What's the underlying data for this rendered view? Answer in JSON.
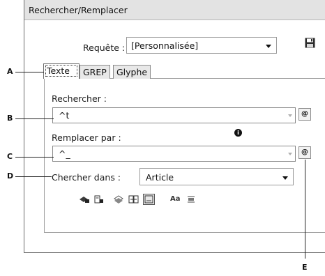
{
  "dialog": {
    "title": "Rechercher/Remplacer",
    "query_label": "Requête :",
    "query_value": "[Personnalisée]"
  },
  "tabs": [
    {
      "label": "Texte",
      "active": true
    },
    {
      "label": "GREP",
      "active": false
    },
    {
      "label": "Glyphe",
      "active": false
    }
  ],
  "find": {
    "label": "Rechercher :",
    "value": "^t"
  },
  "replace": {
    "label": "Remplacer par :",
    "value": "^_"
  },
  "search_in": {
    "label": "Chercher dans :",
    "value": "Article"
  },
  "options_text": "Aa",
  "callouts": [
    "A",
    "B",
    "C",
    "D",
    "E"
  ],
  "info_glyph": "i",
  "at_glyph": "@"
}
